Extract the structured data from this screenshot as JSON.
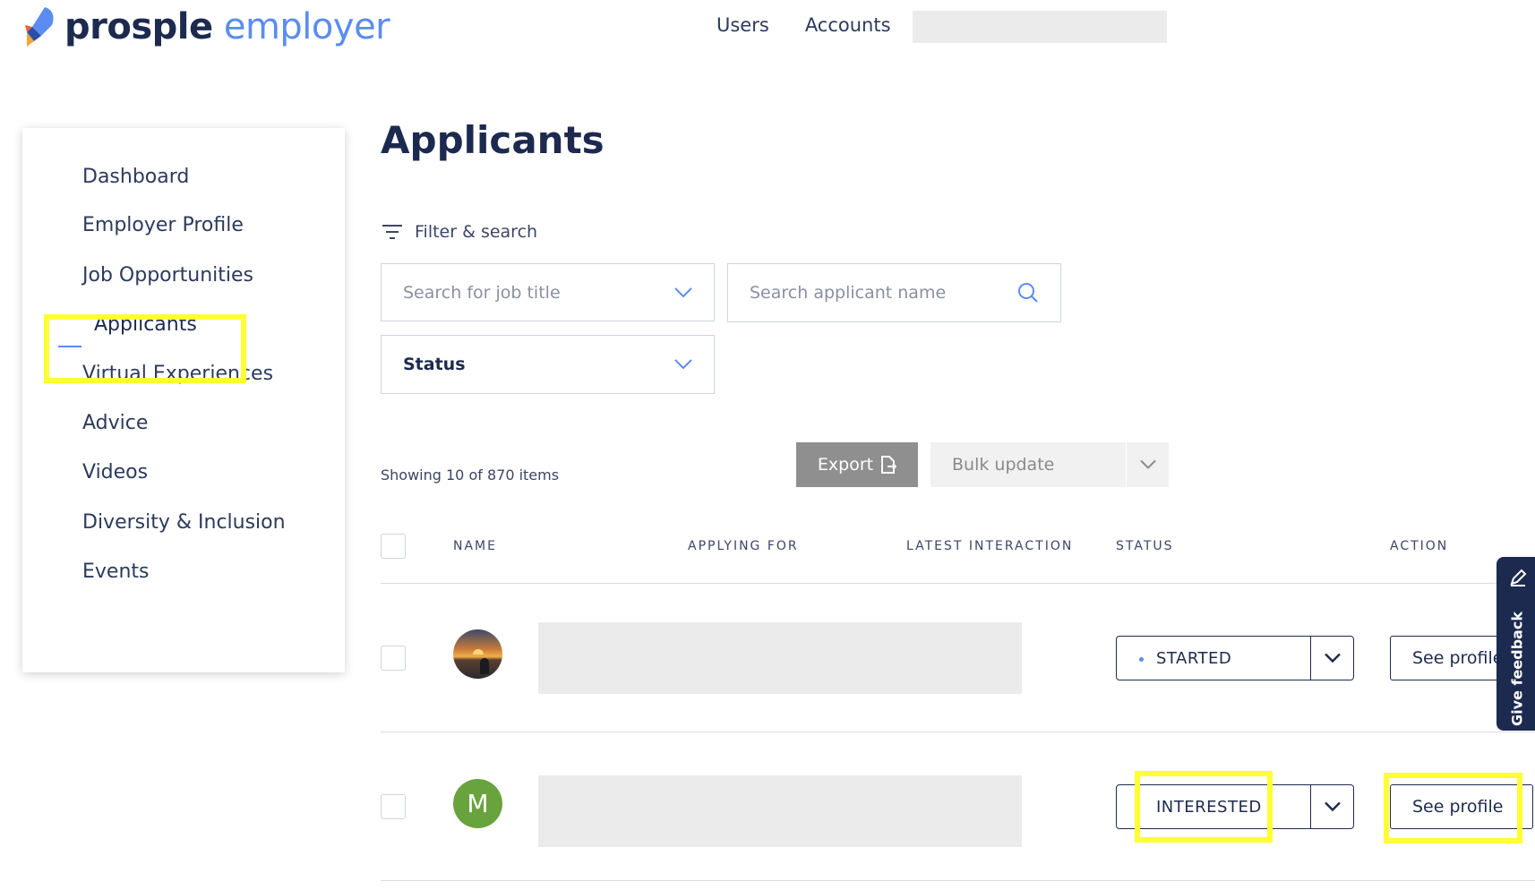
{
  "header": {
    "logo_word1": "prosple",
    "logo_word2": "employer",
    "nav": [
      "Users",
      "Accounts"
    ]
  },
  "sidebar": {
    "items": [
      {
        "label": "Dashboard"
      },
      {
        "label": "Employer Profile"
      },
      {
        "label": "Job Opportunities"
      },
      {
        "label": "Applicants",
        "active": true
      },
      {
        "label": "Virtual Experiences"
      },
      {
        "label": "Advice"
      },
      {
        "label": "Videos"
      },
      {
        "label": "Diversity & Inclusion"
      },
      {
        "label": "Events"
      }
    ]
  },
  "main": {
    "title": "Applicants",
    "filter_label": "Filter & search",
    "job_title_placeholder": "Search for job title",
    "applicant_placeholder": "Search applicant name",
    "status_label": "Status",
    "showing": "Showing 10 of 870 items",
    "export_label": "Export",
    "bulk_update_label": "Bulk update",
    "columns": [
      "NAME",
      "APPLYING FOR",
      "LATEST INTERACTION",
      "STATUS",
      "ACTION"
    ],
    "rows": [
      {
        "avatar": "photo",
        "status": "STARTED",
        "action": "See profile"
      },
      {
        "avatar": "M",
        "status": "INTERESTED",
        "action": "See profile"
      }
    ]
  },
  "feedback": {
    "label": "Give feedback"
  },
  "colors": {
    "brand_navy": "#1d2a4f",
    "brand_blue": "#5b8cf0",
    "highlight": "#ffff33",
    "avatar_green": "#69a33e"
  }
}
